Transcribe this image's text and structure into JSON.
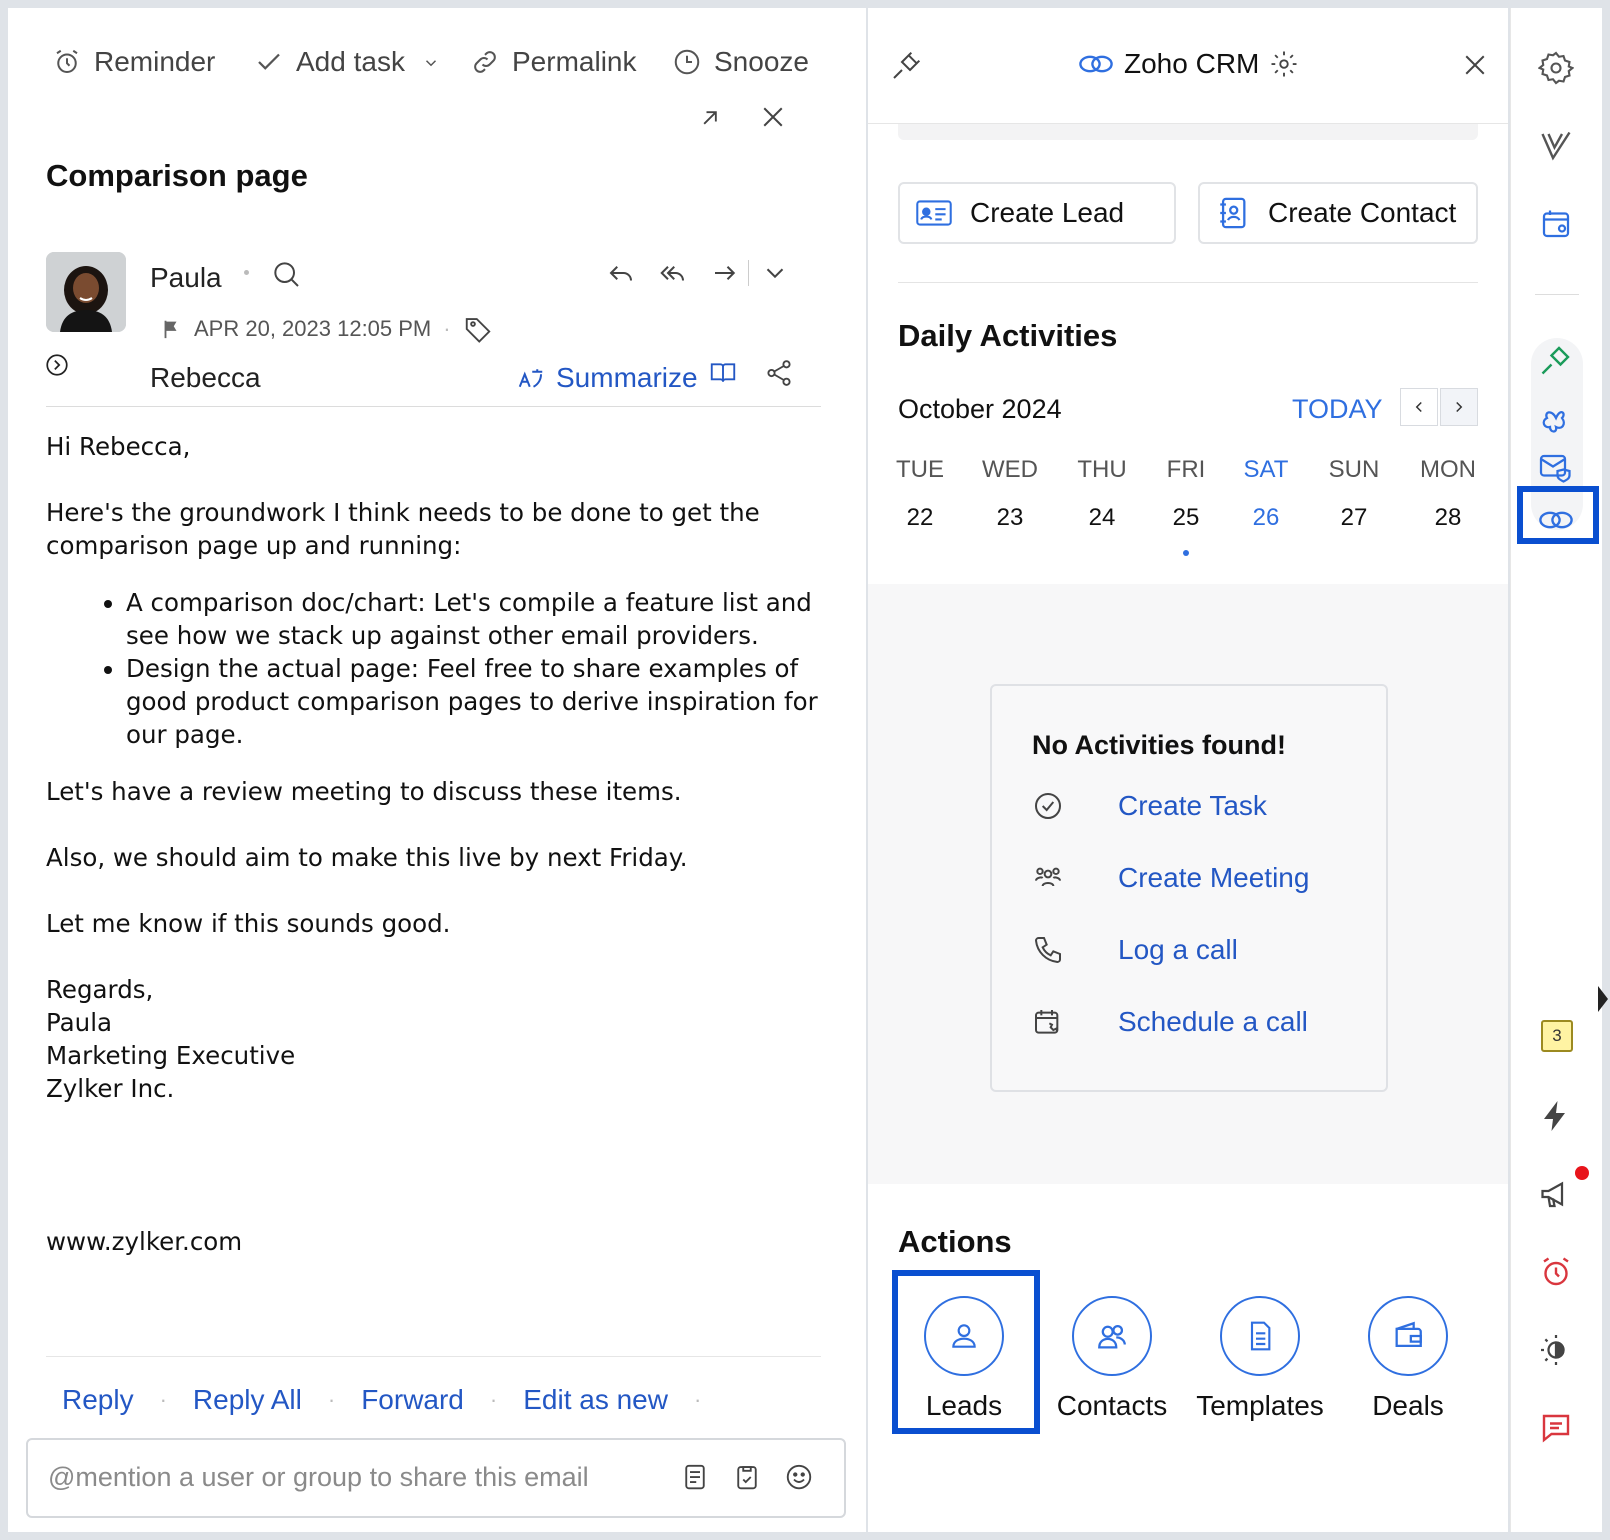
{
  "mail": {
    "toolbar": {
      "reminder": "Reminder",
      "add_task": "Add task",
      "permalink": "Permalink",
      "snooze": "Snooze"
    },
    "subject": "Comparison page",
    "sender": "Paula",
    "date": "APR 20, 2023 12:05 PM",
    "recipient": "Rebecca",
    "summarize": "Summarize",
    "body": {
      "greeting": "Hi Rebecca,",
      "intro": "Here's the groundwork I think needs to be done to get the comparison page up and running:",
      "bullets": [
        "A comparison doc/chart: Let's compile a feature list and see how we stack up against other email providers.",
        "Design the actual page: Feel free to share examples of good product comparison pages to derive inspiration for our page."
      ],
      "para1": "Let's have a review meeting to discuss these items.",
      "para2": "Also, we should aim to make this live by next Friday.",
      "para3": "Let me know if this sounds good.",
      "signature": "Regards,\nPaula\nMarketing Executive\nZylker Inc.",
      "website": "www.zylker.com"
    },
    "reply_links": {
      "reply": "Reply",
      "reply_all": "Reply All",
      "forward": "Forward",
      "edit_as_new": "Edit as new"
    },
    "mention_placeholder": "@mention a user or group to share this email"
  },
  "crm": {
    "title": "Zoho CRM",
    "create_lead": "Create Lead",
    "create_contact": "Create Contact",
    "daily_title": "Daily Activities",
    "month": "October 2024",
    "today": "TODAY",
    "days": [
      {
        "name": "TUE",
        "num": "22"
      },
      {
        "name": "WED",
        "num": "23"
      },
      {
        "name": "THU",
        "num": "24"
      },
      {
        "name": "FRI",
        "num": "25"
      },
      {
        "name": "SAT",
        "num": "26"
      },
      {
        "name": "SUN",
        "num": "27"
      },
      {
        "name": "MON",
        "num": "28"
      }
    ],
    "no_activities": "No Activities found!",
    "activity_links": {
      "task": "Create Task",
      "meeting": "Create Meeting",
      "call": "Log a call",
      "schedule": "Schedule a call"
    },
    "actions_title": "Actions",
    "actions": {
      "leads": "Leads",
      "contacts": "Contacts",
      "templates": "Templates",
      "deals": "Deals"
    }
  },
  "rail": {
    "notes_badge": "3"
  },
  "colors": {
    "link_blue": "#2357c4",
    "accent_blue": "#2f6fe0",
    "highlight": "#0a4fd0",
    "notification_red": "#e8141b"
  }
}
